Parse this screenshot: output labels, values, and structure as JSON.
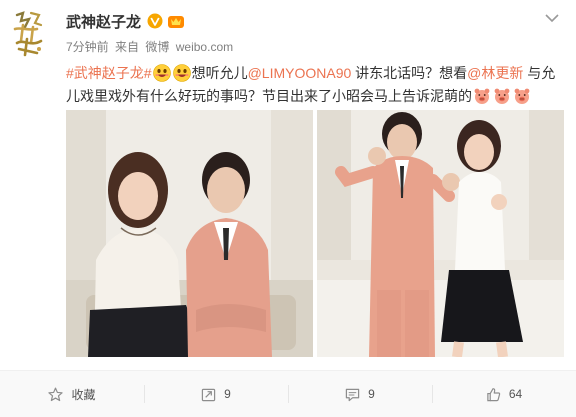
{
  "user": {
    "name": "武神赵子龙",
    "verified_icon": "verified-v-icon",
    "vip_icon": "member-crown-icon"
  },
  "meta": {
    "time": "7分钟前",
    "from": "来自",
    "source": "微博",
    "site": "weibo.com"
  },
  "post": {
    "hashtag": "#武神赵子龙#",
    "text1": "想听允儿",
    "mention1": "@LIMYOONA90",
    "text2": " 讲东北话吗？想看",
    "mention2": "@林更新",
    "text3": " 与允儿戏里戏外有什么好玩的事吗？节目出来了小昭会马上告诉泥萌的"
  },
  "colors": {
    "accent": "#eb7350",
    "verified": "#f7a600"
  },
  "actions": [
    {
      "label": "收藏",
      "icon": "star-icon"
    },
    {
      "label": "9",
      "icon": "repost-icon"
    },
    {
      "label": "9",
      "icon": "comment-icon"
    },
    {
      "label": "64",
      "icon": "thumbs-up-icon"
    }
  ]
}
